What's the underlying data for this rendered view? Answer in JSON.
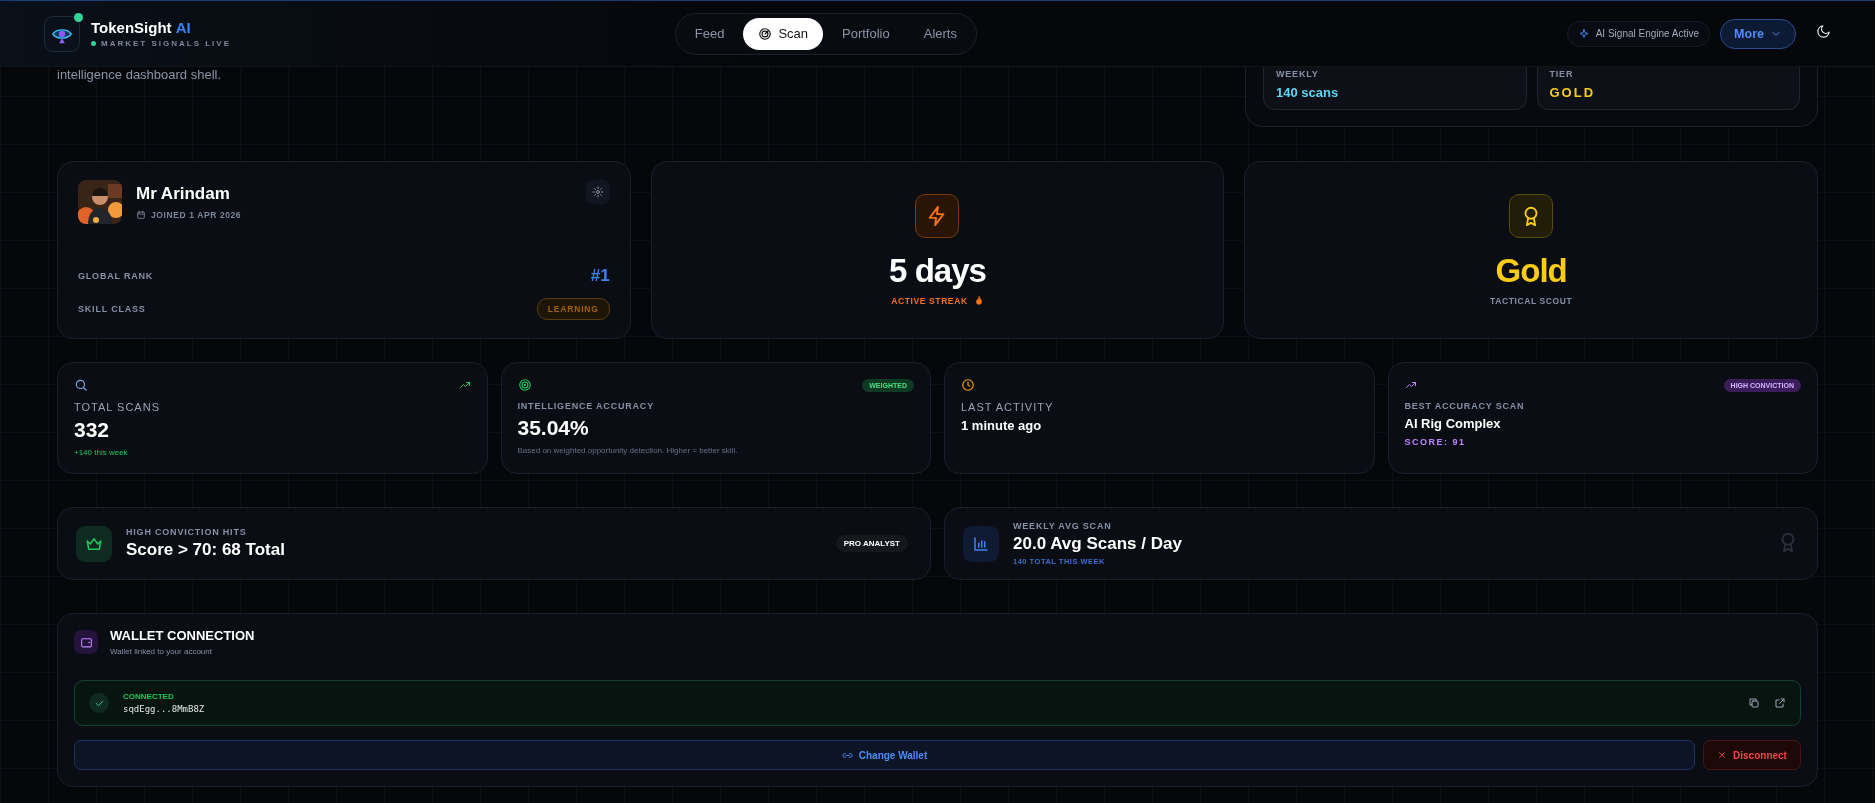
{
  "brand": {
    "name": "TokenSight",
    "suffix": "AI",
    "status": "MARKET SIGNALS LIVE",
    "live": true
  },
  "nav": [
    {
      "label": "Feed",
      "selected": false
    },
    {
      "label": "Scan",
      "selected": true,
      "icon": true
    },
    {
      "label": "Portfolio",
      "selected": false
    },
    {
      "label": "Alerts",
      "selected": false
    }
  ],
  "engine_badge": "AI Signal Engine Active",
  "more_button": "More",
  "intro": "intelligence dashboard shell.",
  "summary": [
    {
      "kind": "scans",
      "label": "WEEKLY",
      "value": "140 scans"
    },
    {
      "kind": "tier",
      "label": "TIER",
      "value": "GOLD"
    }
  ],
  "profile": {
    "name": "Mr Arindam",
    "joined": "JOINED 1 APR 2026",
    "rows": [
      {
        "kind": "rank",
        "label": "GLOBAL RANK",
        "value": "#1"
      },
      {
        "kind": "badge",
        "label": "SKILL CLASS",
        "value": "LEARNING"
      }
    ]
  },
  "streak": {
    "value": "5 days",
    "label": "ACTIVE STREAK"
  },
  "tier_card": {
    "value": "Gold",
    "label": "TACTICAL SCOUT"
  },
  "stats": [
    {
      "kind": "scans",
      "label": "TOTAL SCANS",
      "value": "332",
      "note": "+140 this week"
    },
    {
      "kind": "accuracy",
      "label": "INTELLIGENCE ACCURACY",
      "badge": "WEIGHTED",
      "value": "35.04%",
      "note": "Based on weighted opportunity detection. Higher = better skill."
    },
    {
      "kind": "activity",
      "label": "LAST ACTIVITY",
      "value": "1 minute ago"
    },
    {
      "kind": "best",
      "label": "BEST ACCURACY SCAN",
      "badge": "HIGH CONVICTION",
      "value": "AI Rig Complex",
      "note": "SCORE: 91"
    }
  ],
  "highlights": [
    {
      "kind": "conviction",
      "label": "HIGH CONVICTION HITS",
      "value": "Score > 70: 68 Total",
      "badge": "PRO ANALYST"
    },
    {
      "kind": "weekly",
      "label": "WEEKLY AVG SCAN",
      "value": "20.0 Avg Scans / Day",
      "note": "140 TOTAL THIS WEEK"
    }
  ],
  "wallet": {
    "title": "WALLET CONNECTION",
    "subtitle": "Wallet linked to your account",
    "connected": true,
    "status": "CONNECTED",
    "address": "sqdEgg...8MmB8Z",
    "change_button": "Change Wallet",
    "disconnect_button": "Disconnect"
  }
}
